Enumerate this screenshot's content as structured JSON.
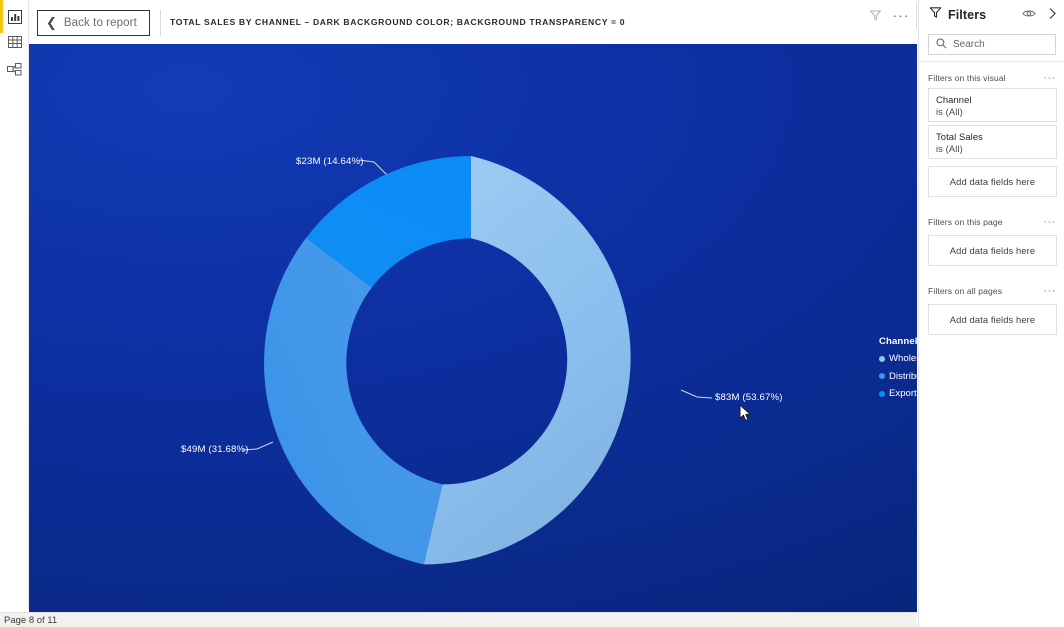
{
  "app": {
    "rail": [
      {
        "name": "report-view",
        "icon": "bar-chart-icon",
        "label": "Report"
      },
      {
        "name": "data-view",
        "icon": "table-icon",
        "label": "Data"
      },
      {
        "name": "model-view",
        "icon": "model-relationships-icon",
        "label": "Model"
      }
    ]
  },
  "topbar": {
    "back_label": "Back to report",
    "back_icon": "chevron-left-icon",
    "visual_title": "TOTAL SALES BY CHANNEL – DARK BACKGROUND COLOR; BACKGROUND TRANSPARENCY = 0",
    "filter_icon": "filter-icon",
    "more_label": "···"
  },
  "statusbar": {
    "page_indicator": "Page 8 of 11"
  },
  "filters": {
    "title": "Filters",
    "title_icon": "filter-icon",
    "eye_icon": "eye-icon",
    "collapse_icon": "chevron-right-icon",
    "search_placeholder": "Search",
    "search_value": "Search",
    "search_icon": "search-icon",
    "more_label": "···",
    "sections": [
      {
        "heading": "Filters on this visual",
        "cards": [
          {
            "field": "Channel",
            "condition": "is (All)"
          },
          {
            "field": "Total Sales",
            "condition": "is (All)"
          }
        ],
        "dropzone": "Add data fields here"
      },
      {
        "heading": "Filters on this page",
        "cards": [],
        "dropzone": "Add data fields here"
      },
      {
        "heading": "Filters on all pages",
        "cards": [],
        "dropzone": "Add data fields here"
      }
    ]
  },
  "chart_data": {
    "type": "pie",
    "variant": "donut",
    "title": "Total Sales by Channel",
    "legend_title": "Channel",
    "legend_position": "right",
    "categories": [
      "Wholesale",
      "Distributor",
      "Export"
    ],
    "values": [
      83,
      49,
      23
    ],
    "value_unit": "$M",
    "percentages": [
      53.67,
      31.68,
      14.64
    ],
    "labels": [
      "$83M (53.67%)",
      "$49M (31.68%)",
      "$23M (14.64%)"
    ],
    "colors": [
      "#93c5ef",
      "#3d96ea",
      "#0d8ef5"
    ],
    "background_color": "#0d30a4",
    "background_transparency": 0,
    "inner_radius_ratio": 0.6,
    "grid": false
  }
}
